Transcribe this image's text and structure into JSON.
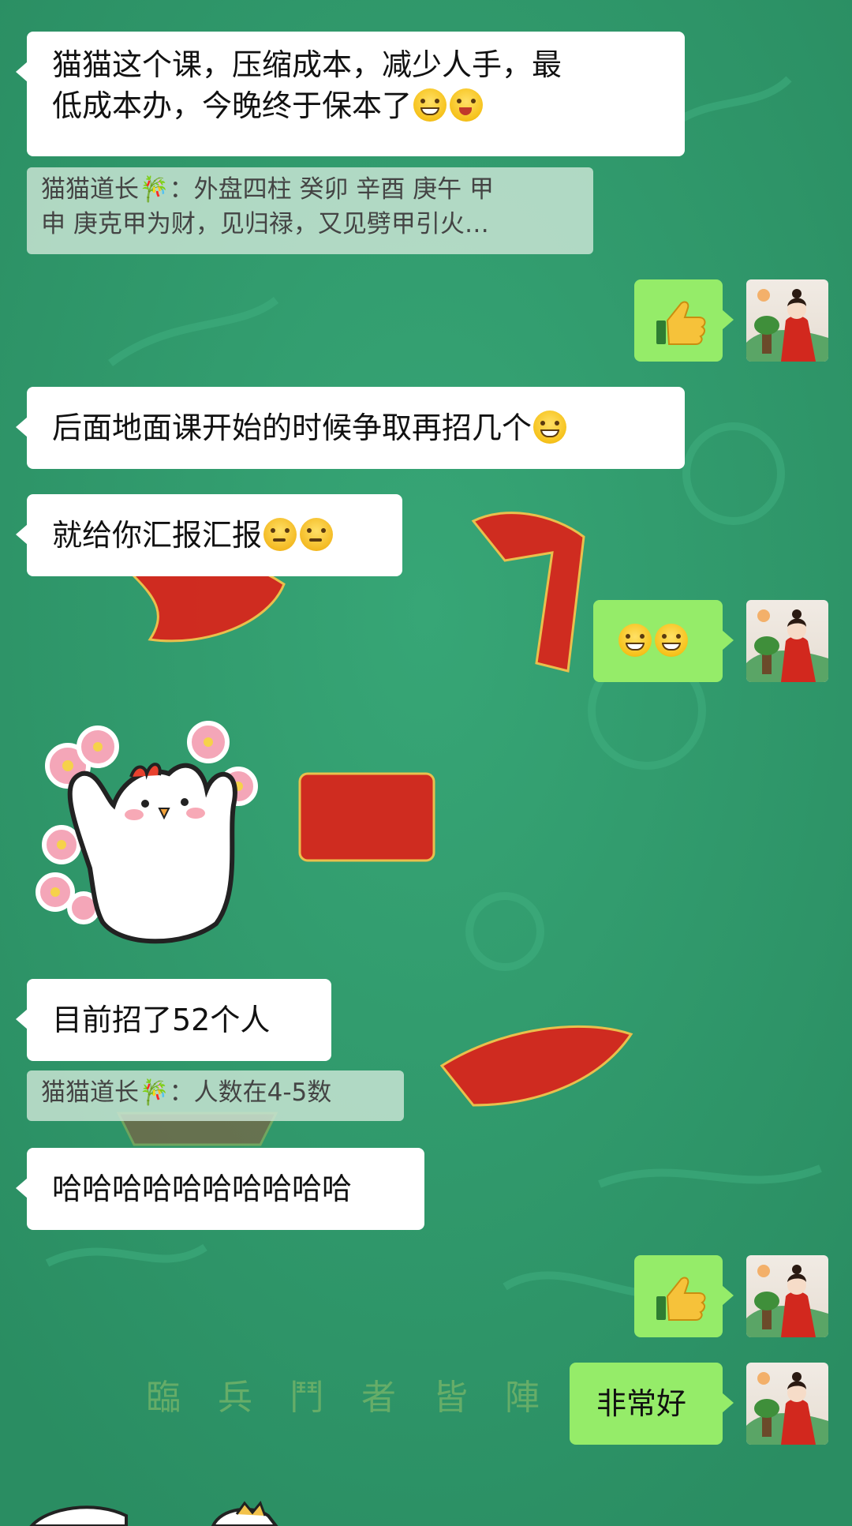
{
  "messages": {
    "m1_line1": "猫猫这个课，压缩成本，减少人手，最",
    "m1_line2": "低成本办，今晚终于保本了",
    "q1_line1": "猫猫道长🎋：外盘四柱 癸卯 辛酉 庚午 甲",
    "q1_line2": "申  庚克甲为财，见归禄，又见劈甲引火…",
    "m2": "后面地面课开始的时候争取再招几个",
    "m3": "就给你汇报汇报",
    "m4": "目前招了52个人",
    "q2": "猫猫道长🎋：人数在4-5数",
    "m5": "哈哈哈哈哈哈哈哈哈哈",
    "m6": "非常好"
  },
  "background_text": "臨 兵 鬥 者 皆 陣 列 前",
  "icons": {
    "thumb": "thumbs-up-icon",
    "grin": "grinning-face-icon",
    "wink": "winking-face-icon",
    "shy": "shy-face-icon",
    "sticker": "chicken-sticker"
  },
  "colors": {
    "background": "#2f9a6c",
    "incoming_bubble": "#ffffff",
    "outgoing_bubble": "#95ec69",
    "quote_bubble": "#cde6d7",
    "ornament_red": "#d8261c"
  }
}
